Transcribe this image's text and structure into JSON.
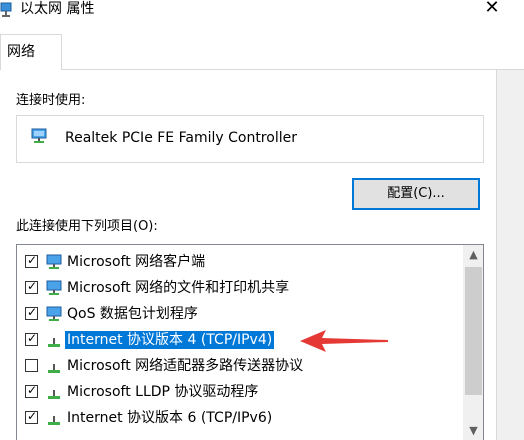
{
  "window": {
    "title": "以太网 属性"
  },
  "tabs": [
    {
      "label": "网络"
    }
  ],
  "connect_using": {
    "label": "连接时使用:",
    "adapter": "Realtek PCIe FE Family Controller",
    "configure_button": "配置(C)..."
  },
  "items_section": {
    "label": "此连接使用下列项目(O):",
    "items": [
      {
        "label": "Microsoft 网络客户端",
        "checked": true,
        "icon": "network-client-icon"
      },
      {
        "label": "Microsoft 网络的文件和打印机共享",
        "checked": true,
        "icon": "file-print-sharing-icon"
      },
      {
        "label": "QoS 数据包计划程序",
        "checked": true,
        "icon": "qos-scheduler-icon"
      },
      {
        "label": "Internet 协议版本 4 (TCP/IPv4)",
        "checked": true,
        "selected": true,
        "icon": "protocol-icon"
      },
      {
        "label": "Microsoft 网络适配器多路传送器协议",
        "checked": false,
        "icon": "protocol-icon"
      },
      {
        "label": "Microsoft LLDP 协议驱动程序",
        "checked": true,
        "icon": "protocol-icon"
      },
      {
        "label": "Internet 协议版本 6 (TCP/IPv6)",
        "checked": true,
        "icon": "protocol-icon"
      }
    ]
  },
  "colors": {
    "selection": "#0078d7",
    "annotation_arrow": "#e53935"
  }
}
